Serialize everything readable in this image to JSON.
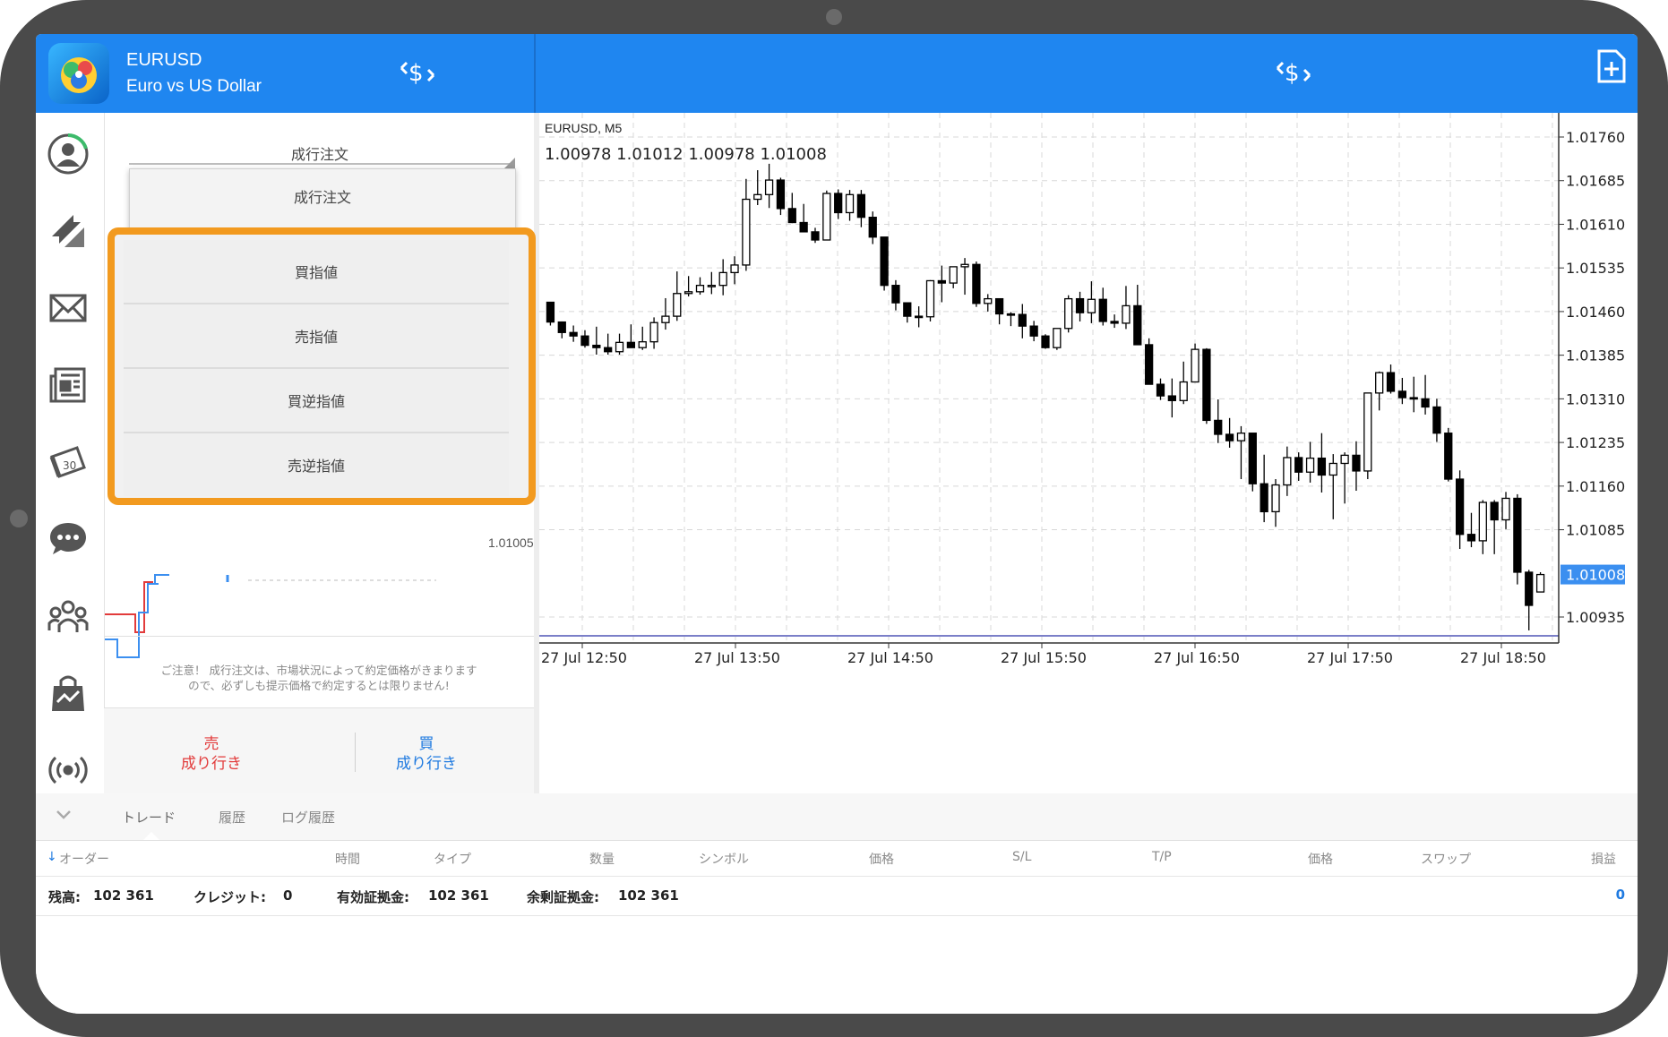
{
  "header": {
    "symbol": "EURUSD",
    "description": "Euro vs US Dollar",
    "icons": [
      "app-logo-icon",
      "currency-exchange-icon",
      "new-order-icon"
    ]
  },
  "sidebar": {
    "items": [
      "account-icon",
      "trade-arrows-icon",
      "mail-icon",
      "news-icon",
      "calendar-icon",
      "chat-icon",
      "community-icon",
      "market-icon",
      "signal-icon"
    ]
  },
  "order_panel": {
    "type_label": "成行注文",
    "dropdown": {
      "selected": "成行注文",
      "options": [
        "買指値",
        "売指値",
        "買逆指値",
        "売逆指値"
      ]
    },
    "mini_price": "1.01005",
    "notice_line1": "ご注意！ 成行注文は、市場状況によって約定価格がきまります",
    "notice_line2": "ので、必ずしも提示価格で約定するとは限りません!",
    "sell_line1": "売",
    "sell_line2": "成り行き",
    "buy_line1": "買",
    "buy_line2": "成り行き"
  },
  "chart_data": {
    "type": "candlestick",
    "symbol_label": "EURUSD, M5",
    "ohlc_label": "1.00978 1.01012 1.00978 1.01008",
    "y_ticks": [
      "1.01760",
      "1.01685",
      "1.01610",
      "1.01535",
      "1.01460",
      "1.01385",
      "1.01310",
      "1.01235",
      "1.01160",
      "1.01085",
      "1.01008",
      "1.00935"
    ],
    "x_ticks": [
      "27 Jul 12:50",
      "27 Jul 13:50",
      "27 Jul 14:50",
      "27 Jul 15:50",
      "27 Jul 16:50",
      "27 Jul 17:50",
      "27 Jul 18:50"
    ],
    "current_price": "1.01008",
    "ylim": [
      1.009,
      1.0179
    ],
    "candles": [
      [
        1.01476,
        1.01472,
        1.01436,
        1.01442
      ],
      [
        1.01442,
        1.01443,
        1.01414,
        1.01424
      ],
      [
        1.01424,
        1.01436,
        1.01408,
        1.01418
      ],
      [
        1.01418,
        1.01428,
        1.01398,
        1.01402
      ],
      [
        1.01402,
        1.01434,
        1.01386,
        1.01398
      ],
      [
        1.01398,
        1.01422,
        1.01386,
        1.01391
      ],
      [
        1.01391,
        1.01422,
        1.01386,
        1.01407
      ],
      [
        1.01407,
        1.01438,
        1.01398,
        1.01398
      ],
      [
        1.01398,
        1.01434,
        1.01394,
        1.01408
      ],
      [
        1.01408,
        1.0145,
        1.01396,
        1.01441
      ],
      [
        1.01441,
        1.01483,
        1.01429,
        1.01452
      ],
      [
        1.01452,
        1.01529,
        1.01444,
        1.01491
      ],
      [
        1.01491,
        1.01521,
        1.01486,
        1.01494
      ],
      [
        1.01494,
        1.01519,
        1.01489,
        1.01505
      ],
      [
        1.01505,
        1.01528,
        1.0149,
        1.01505
      ],
      [
        1.01505,
        1.0155,
        1.01488,
        1.01527
      ],
      [
        1.01527,
        1.01555,
        1.01507,
        1.0154
      ],
      [
        1.0154,
        1.01688,
        1.0153,
        1.01653
      ],
      [
        1.01653,
        1.01703,
        1.01643,
        1.01661
      ],
      [
        1.01661,
        1.01714,
        1.01638,
        1.01686
      ],
      [
        1.01686,
        1.0169,
        1.01626,
        1.01637
      ],
      [
        1.01637,
        1.01664,
        1.01612,
        1.01613
      ],
      [
        1.01613,
        1.01645,
        1.01603,
        1.01597
      ],
      [
        1.01597,
        1.01604,
        1.01578,
        1.01583
      ],
      [
        1.01583,
        1.01668,
        1.01589,
        1.01663
      ],
      [
        1.01663,
        1.0167,
        1.01619,
        1.0163
      ],
      [
        1.0163,
        1.01669,
        1.01616,
        1.01661
      ],
      [
        1.01661,
        1.01669,
        1.01605,
        1.01622
      ],
      [
        1.01622,
        1.01632,
        1.01576,
        1.01588
      ],
      [
        1.01588,
        1.01577,
        1.01496,
        1.01505
      ],
      [
        1.01505,
        1.01514,
        1.01462,
        1.01475
      ],
      [
        1.01475,
        1.01474,
        1.01441,
        1.01452
      ],
      [
        1.01452,
        1.01469,
        1.01433,
        1.01451
      ],
      [
        1.01451,
        1.01514,
        1.01443,
        1.01513
      ],
      [
        1.01513,
        1.01539,
        1.01476,
        1.01509
      ],
      [
        1.01509,
        1.01537,
        1.015,
        1.01537
      ],
      [
        1.01537,
        1.01552,
        1.01489,
        1.01541
      ],
      [
        1.01541,
        1.01546,
        1.01468,
        1.01474
      ],
      [
        1.01474,
        1.0149,
        1.0146,
        1.01482
      ],
      [
        1.01482,
        1.01471,
        1.01438,
        1.01456
      ],
      [
        1.01456,
        1.01459,
        1.01435,
        1.01455
      ],
      [
        1.01455,
        1.01473,
        1.01414,
        1.01435
      ],
      [
        1.01435,
        1.01444,
        1.01409,
        1.01418
      ],
      [
        1.01418,
        1.01421,
        1.01396,
        1.01398
      ],
      [
        1.01398,
        1.01431,
        1.01394,
        1.01431
      ],
      [
        1.01431,
        1.01488,
        1.01424,
        1.01482
      ],
      [
        1.01482,
        1.01494,
        1.01443,
        1.01458
      ],
      [
        1.01458,
        1.01512,
        1.0144,
        1.01481
      ],
      [
        1.01481,
        1.01501,
        1.01436,
        1.01443
      ],
      [
        1.01443,
        1.01455,
        1.01432,
        1.0144
      ],
      [
        1.0144,
        1.01504,
        1.0143,
        1.0147
      ],
      [
        1.0147,
        1.01506,
        1.01416,
        1.01403
      ],
      [
        1.01403,
        1.01414,
        1.01337,
        1.01335
      ],
      [
        1.01335,
        1.01345,
        1.01308,
        1.01315
      ],
      [
        1.01315,
        1.01345,
        1.01278,
        1.01307
      ],
      [
        1.01307,
        1.01374,
        1.01301,
        1.01339
      ],
      [
        1.01339,
        1.01405,
        1.01352,
        1.01395
      ],
      [
        1.01395,
        1.01397,
        1.01267,
        1.01273
      ],
      [
        1.01273,
        1.01309,
        1.01234,
        1.01249
      ],
      [
        1.01249,
        1.01277,
        1.01226,
        1.01238
      ],
      [
        1.01238,
        1.01263,
        1.01172,
        1.01251
      ],
      [
        1.01251,
        1.0124,
        1.01151,
        1.01164
      ],
      [
        1.01164,
        1.01214,
        1.01098,
        1.01116
      ],
      [
        1.01116,
        1.01172,
        1.0109,
        1.01162
      ],
      [
        1.01162,
        1.01228,
        1.01143,
        1.01209
      ],
      [
        1.01209,
        1.01218,
        1.01169,
        1.01184
      ],
      [
        1.01184,
        1.01236,
        1.01166,
        1.01208
      ],
      [
        1.01208,
        1.01251,
        1.01149,
        1.01179
      ],
      [
        1.01179,
        1.01215,
        1.01103,
        1.01199
      ],
      [
        1.01199,
        1.01218,
        1.0113,
        1.01213
      ],
      [
        1.01213,
        1.01237,
        1.01152,
        1.01186
      ],
      [
        1.01186,
        1.01318,
        1.01172,
        1.0132
      ],
      [
        1.0132,
        1.01357,
        1.0129,
        1.01355
      ],
      [
        1.01355,
        1.01369,
        1.01319,
        1.01323
      ],
      [
        1.01323,
        1.01346,
        1.01301,
        1.01312
      ],
      [
        1.01312,
        1.01348,
        1.01287,
        1.0131
      ],
      [
        1.0131,
        1.01351,
        1.01283,
        1.01296
      ],
      [
        1.01296,
        1.0131,
        1.01236,
        1.01251
      ],
      [
        1.01251,
        1.0126,
        1.01168,
        1.01172
      ],
      [
        1.01172,
        1.01187,
        1.01052,
        1.01077
      ],
      [
        1.01077,
        1.01114,
        1.01055,
        1.01066
      ],
      [
        1.01066,
        1.01136,
        1.01043,
        1.01132
      ],
      [
        1.01132,
        1.01136,
        1.01043,
        1.01102
      ],
      [
        1.01102,
        1.0115,
        1.01086,
        1.01139
      ],
      [
        1.01139,
        1.01146,
        1.00991,
        1.01012
      ],
      [
        1.01012,
        1.01016,
        1.00912,
        1.00955
      ],
      [
        1.00978,
        1.01012,
        1.00978,
        1.01008
      ]
    ]
  },
  "bottom": {
    "tabs": [
      "トレード",
      "履歴",
      "ログ履歴"
    ],
    "columns": [
      "オーダー",
      "時間",
      "タイプ",
      "数量",
      "シンボル",
      "価格",
      "S/L",
      "T/P",
      "価格",
      "スワップ",
      "損益"
    ],
    "balance_label": "残高:",
    "balance_value": "102 361",
    "credit_label": "クレジット:",
    "credit_value": "0",
    "equity_label": "有効証拠金:",
    "equity_value": "102 361",
    "free_margin_label": "余剰証拠金:",
    "free_margin_value": "102 361",
    "profit_total": "0"
  },
  "colors": {
    "header": "#1f86f0",
    "highlight": "#f29a1f",
    "sell": "#e23b3b",
    "buy": "#1f7ae0",
    "price_line": "#7b7fc8"
  }
}
